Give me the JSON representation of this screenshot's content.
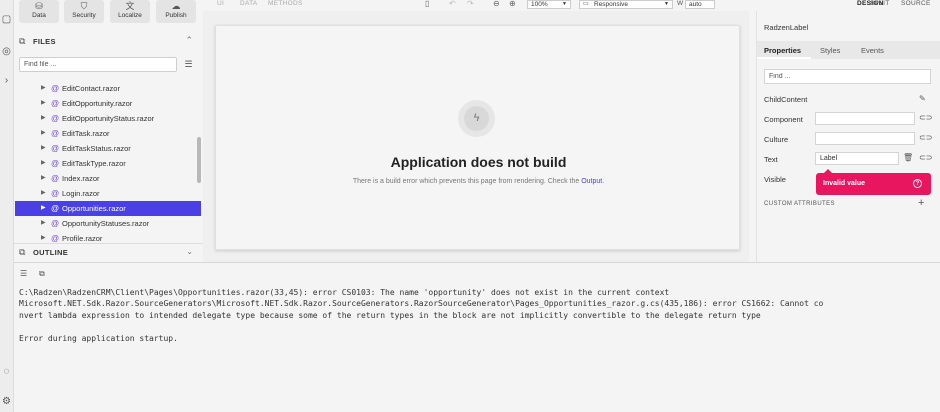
{
  "tools": [
    {
      "label": "Data",
      "icon": "database-icon",
      "glyph": "⛁"
    },
    {
      "label": "Security",
      "icon": "shield-icon",
      "glyph": "⛉"
    },
    {
      "label": "Localize",
      "icon": "translate-icon",
      "glyph": "文"
    },
    {
      "label": "Publish",
      "icon": "cloud-upload-icon",
      "glyph": "☁"
    }
  ],
  "files": {
    "title": "FILES",
    "find_placeholder": "Find file ...",
    "items": [
      "EditContact.razor",
      "EditOpportunity.razor",
      "EditOpportunityStatus.razor",
      "EditTask.razor",
      "EditTaskStatus.razor",
      "EditTaskType.razor",
      "Index.razor",
      "Login.razor",
      "Opportunities.razor",
      "OpportunityStatuses.razor",
      "Profile.razor"
    ],
    "active_index": 8
  },
  "outline": {
    "title": "OUTLINE"
  },
  "toolbar": {
    "tabs": [
      "UI",
      "DATA",
      "METHODS"
    ],
    "zoom": "100%",
    "device": "Responsive",
    "width_label": "W",
    "width_value": "auto",
    "view_modes": [
      "DESIGN",
      "SPLIT",
      "SOURCE"
    ],
    "active_mode": "DESIGN"
  },
  "canvas": {
    "error_title": "Application does not build",
    "error_message": "There is a build error which prevents this page from rendering. Check the ",
    "error_link": "Output",
    "error_suffix": "."
  },
  "props": {
    "component": "RadzenLabel",
    "tabs": [
      "Properties",
      "Styles",
      "Events"
    ],
    "active_tab": "Properties",
    "find_placeholder": "Find ...",
    "rows": {
      "child_content": "ChildContent",
      "component": "Component",
      "culture": "Culture",
      "text": "Text",
      "text_value": "Label",
      "visible": "Visible"
    },
    "invalid_message": "Invalid value",
    "custom_attributes": "CUSTOM ATTRIBUTES",
    "accent": "#e8155f"
  },
  "output": {
    "lines": [
      "C:\\Radzen\\RadzenCRM\\Client\\Pages\\Opportunities.razor(33,45): error CS0103: The name 'opportunity' does not exist in the current context",
      "Microsoft.NET.Sdk.Razor.SourceGenerators\\Microsoft.NET.Sdk.Razor.SourceGenerators.RazorSourceGenerator\\Pages_Opportunities_razor.g.cs(435,186): error CS1662: Cannot co",
      "nvert lambda expression to intended delegate type because some of the return types in the block are not implicitly convertible to the delegate return type",
      "",
      "Error during application startup."
    ]
  },
  "colors": {
    "primary": "#4a40e6",
    "razor_at": "#6f48d9"
  }
}
